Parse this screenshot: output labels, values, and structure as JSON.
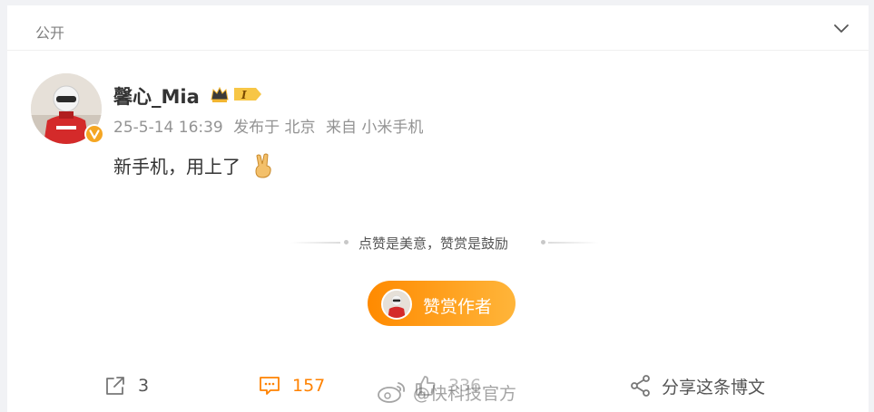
{
  "header": {
    "visibility": "公开"
  },
  "post": {
    "author": "馨心_Mia",
    "meta": {
      "time": "25-5-14 16:39",
      "location": "发布于 北京",
      "source": "来自 小米手机"
    },
    "content": "新手机，用上了"
  },
  "reward": {
    "slogan": "点赞是美意，赞赏是鼓励",
    "button": "赞赏作者"
  },
  "actions": {
    "repost": "3",
    "comment": "157",
    "like": "336",
    "share": "分享这条博文"
  },
  "watermark": "@快科技官方",
  "colors": {
    "accent": "#ff8200",
    "reward_gradient": [
      "#ff8a00",
      "#ffb53a"
    ],
    "meta_text": "#939393"
  },
  "icons": [
    "chevron-down-icon",
    "verified-badge-icon",
    "vip-crown-icon",
    "victory-hand-icon",
    "repost-icon",
    "comment-icon",
    "like-icon",
    "share-icon",
    "weibo-logo-icon"
  ]
}
